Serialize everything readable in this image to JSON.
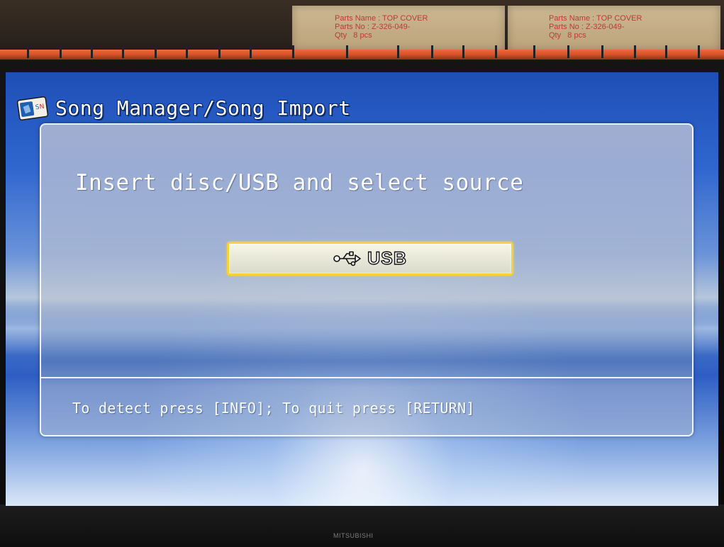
{
  "shelf": {
    "boxes": [
      {
        "label": "Parts Name : TOP COVER\nParts No : Z-326-049-\nQty   8 pcs"
      },
      {
        "label": "Parts Name : TOP COVER\nParts No : Z-326-049-\nQty   8 pcs"
      }
    ]
  },
  "tv": {
    "brand": "MITSUBISHI"
  },
  "screen": {
    "header": {
      "icon": "usb-disc-icon",
      "title": "Song Manager/Song Import"
    },
    "panel": {
      "prompt": "Insert disc/USB and select source",
      "source_button": {
        "icon": "usb-icon",
        "label": "USB"
      },
      "hint": "To detect press [INFO]; To quit press [RETURN]"
    }
  },
  "colors": {
    "selection_border": "#f3d23a",
    "screen_blue": "#2f66cf",
    "text": "#ffffff"
  }
}
